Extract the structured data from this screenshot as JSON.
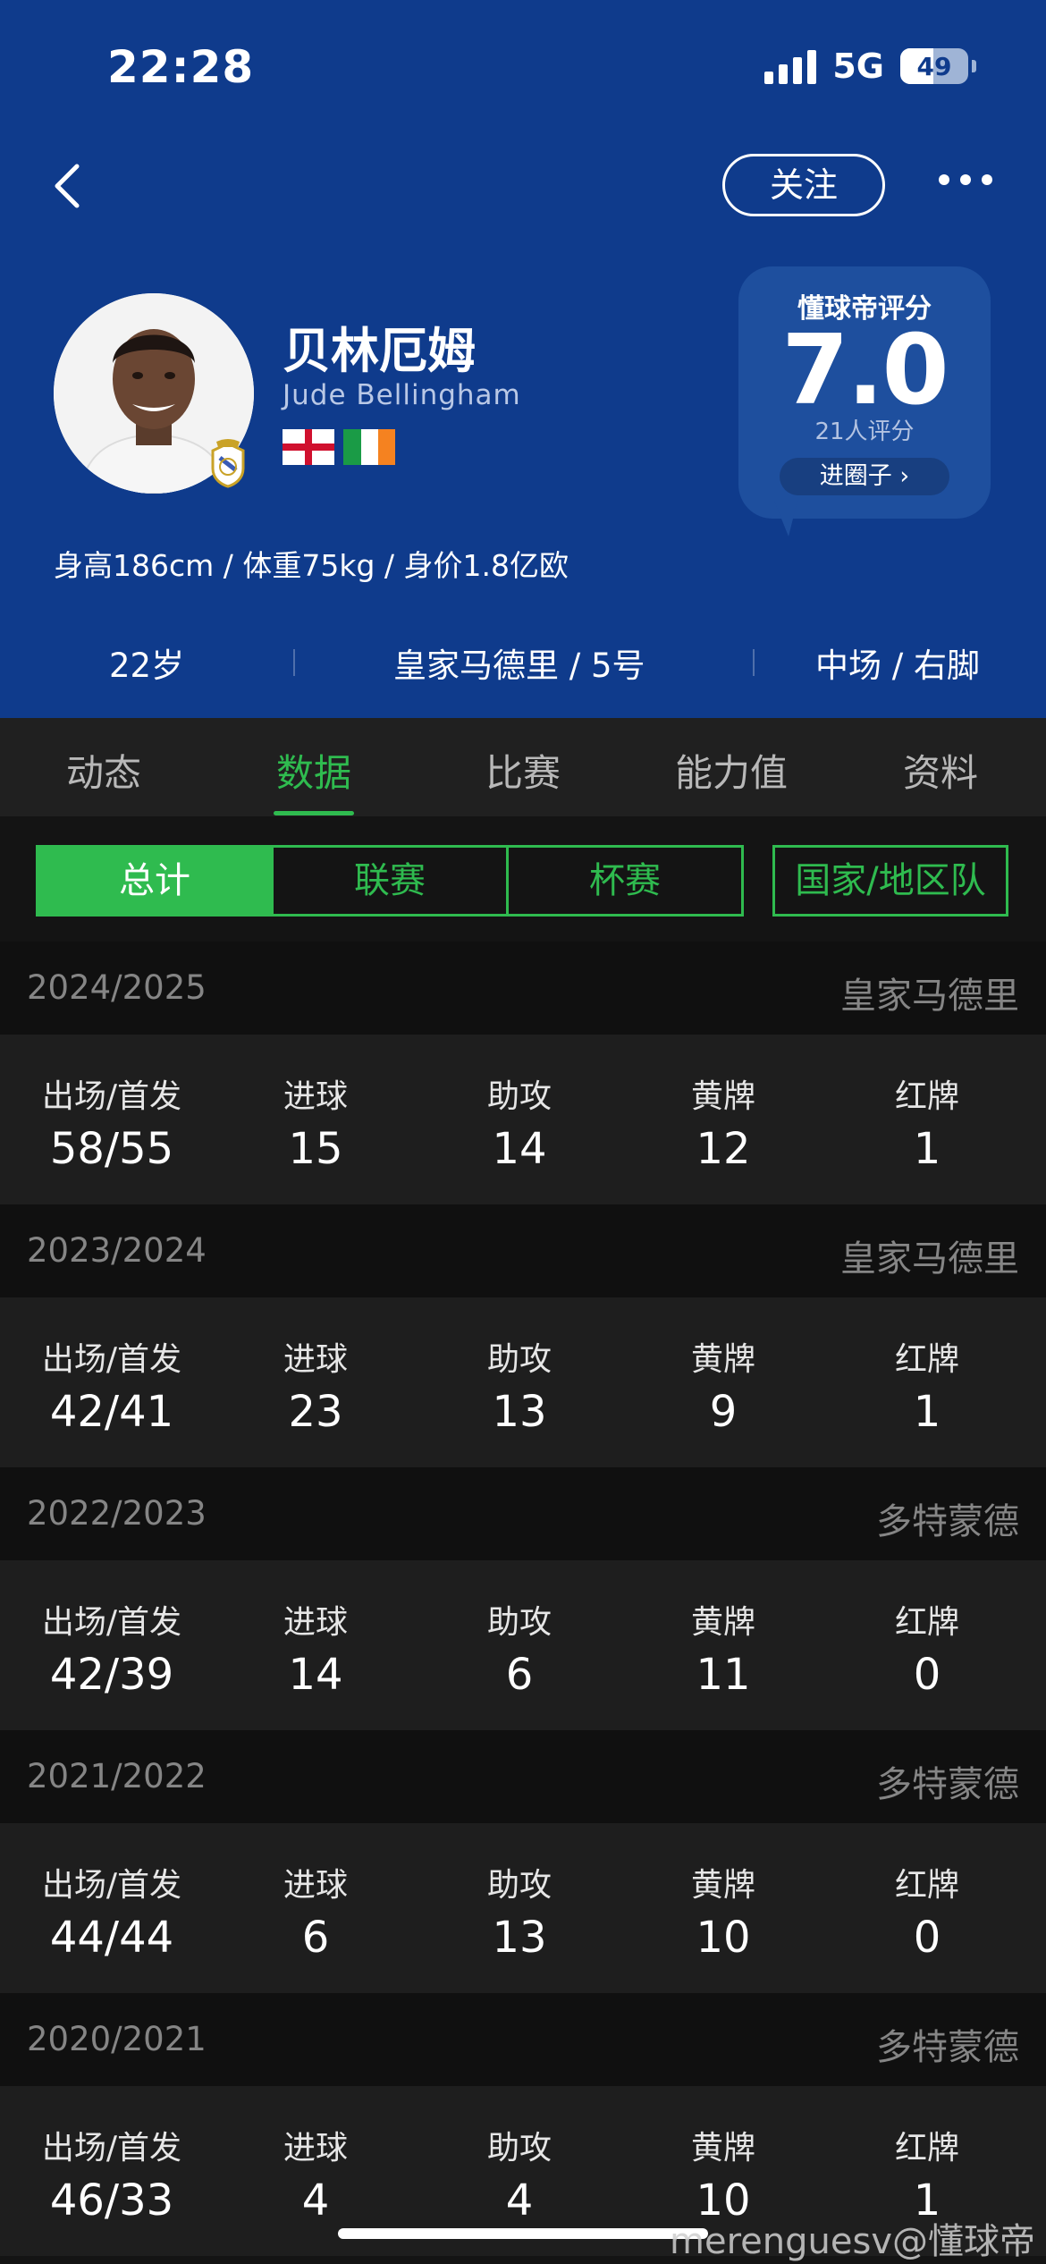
{
  "status_bar": {
    "time": "22:28",
    "network": "5G",
    "battery": "49"
  },
  "header": {
    "follow_label": "关注",
    "player_name": "贝林厄姆",
    "player_name_en": "Jude Bellingham",
    "flags": [
      "England",
      "Ireland"
    ],
    "rating": {
      "label": "懂球帝评分",
      "value": "7.0",
      "count": "21人评分",
      "circle_label": "进圈子 ›"
    },
    "bio": "身高186cm / 体重75kg / 身价1.8亿欧",
    "age": "22岁",
    "club_number": "皇家马德里 / 5号",
    "position_foot": "中场 / 右脚"
  },
  "tabs": [
    "动态",
    "数据",
    "比赛",
    "能力值",
    "资料"
  ],
  "active_tab": "数据",
  "filters": {
    "segments": [
      "总计",
      "联赛",
      "杯赛"
    ],
    "active": "总计",
    "national": "国家/地区队"
  },
  "stat_labels": [
    "出场/首发",
    "进球",
    "助攻",
    "黄牌",
    "红牌"
  ],
  "seasons": [
    {
      "year": "2024/2025",
      "club": "皇家马德里",
      "values": [
        "58/55",
        "15",
        "14",
        "12",
        "1"
      ]
    },
    {
      "year": "2023/2024",
      "club": "皇家马德里",
      "values": [
        "42/41",
        "23",
        "13",
        "9",
        "1"
      ]
    },
    {
      "year": "2022/2023",
      "club": "多特蒙德",
      "values": [
        "42/39",
        "14",
        "6",
        "11",
        "0"
      ]
    },
    {
      "year": "2021/2022",
      "club": "多特蒙德",
      "values": [
        "44/44",
        "6",
        "13",
        "10",
        "0"
      ]
    },
    {
      "year": "2020/2021",
      "club": "多特蒙德",
      "values": [
        "46/33",
        "4",
        "4",
        "10",
        "1"
      ]
    }
  ],
  "watermark": "merenguesv@懂球帝",
  "colors": {
    "header_bg": "#0f3b8c",
    "accent_green": "#2fbb4f",
    "page_bg": "#141414"
  }
}
